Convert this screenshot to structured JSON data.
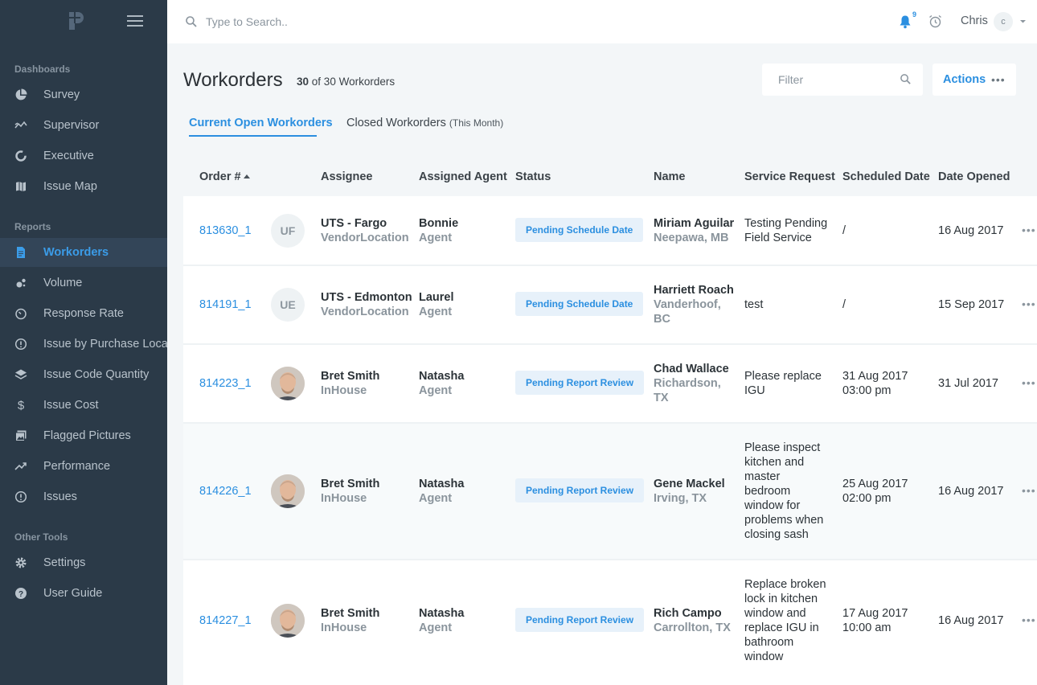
{
  "sidebar": {
    "sections": [
      {
        "label": "Dashboards"
      },
      {
        "label": "Reports"
      },
      {
        "label": "Other Tools"
      }
    ],
    "items": [
      {
        "label": "Survey",
        "icon": "pie-chart-icon"
      },
      {
        "label": "Supervisor",
        "icon": "trend-icon"
      },
      {
        "label": "Executive",
        "icon": "donut-icon"
      },
      {
        "label": "Issue Map",
        "icon": "map-icon"
      },
      {
        "label": "Workorders",
        "icon": "document-icon"
      },
      {
        "label": "Volume",
        "icon": "bubbles-icon"
      },
      {
        "label": "Response Rate",
        "icon": "timer-icon"
      },
      {
        "label": "Issue by Purchase Location",
        "icon": "alert-circle-icon"
      },
      {
        "label": "Issue Code Quantity",
        "icon": "layers-icon"
      },
      {
        "label": "Issue Cost",
        "icon": "dollar-icon"
      },
      {
        "label": "Flagged Pictures",
        "icon": "images-icon"
      },
      {
        "label": "Performance",
        "icon": "trending-up-icon"
      },
      {
        "label": "Issues",
        "icon": "alert-circle-icon"
      },
      {
        "label": "Settings",
        "icon": "gear-icon"
      },
      {
        "label": "User Guide",
        "icon": "help-icon"
      }
    ]
  },
  "topbar": {
    "search_placeholder": "Type to Search..",
    "notification_count": "9",
    "user_name": "Chris",
    "user_initial": "c"
  },
  "header": {
    "title": "Workorders",
    "count_bold": "30",
    "count_rest": "of 30 Workorders",
    "filter_placeholder": "Filter",
    "actions_label": "Actions"
  },
  "tabs": {
    "current": "Current Open Workorders",
    "closed": "Closed Workorders",
    "closed_sub": "(This Month)"
  },
  "columns": {
    "order": "Order #",
    "assignee": "Assignee",
    "agent": "Assigned Agent",
    "status": "Status",
    "name": "Name",
    "service": "Service Request",
    "scheduled": "Scheduled Date",
    "opened": "Date Opened"
  },
  "rows": [
    {
      "order": "813630_1",
      "initials": "UF",
      "assignee": "UTS - Fargo",
      "assignee_type": "VendorLocation",
      "agent": "Bonnie",
      "agent_role": "Agent",
      "status": "Pending Schedule Date",
      "name": "Miriam Aguilar",
      "location": "Neepawa, MB",
      "service": "Testing Pending Field Service",
      "scheduled": "/",
      "scheduled_time": "",
      "opened": "16 Aug 2017"
    },
    {
      "order": "814191_1",
      "initials": "UE",
      "assignee": "UTS - Edmonton",
      "assignee_type": "VendorLocation",
      "agent": "Laurel",
      "agent_role": "Agent",
      "status": "Pending Schedule Date",
      "name": "Harriett Roach",
      "location": "Vanderhoof, BC",
      "service": "test",
      "scheduled": "/",
      "scheduled_time": "",
      "opened": "15 Sep 2017"
    },
    {
      "order": "814223_1",
      "initials": "",
      "assignee": "Bret Smith",
      "assignee_type": "InHouse",
      "agent": "Natasha",
      "agent_role": "Agent",
      "status": "Pending Report Review",
      "name": "Chad Wallace",
      "location": "Richardson, TX",
      "service": "Please replace IGU",
      "scheduled": "31 Aug 2017",
      "scheduled_time": "03:00 pm",
      "opened": "31 Jul 2017"
    },
    {
      "order": "814226_1",
      "initials": "",
      "assignee": "Bret Smith",
      "assignee_type": "InHouse",
      "agent": "Natasha",
      "agent_role": "Agent",
      "status": "Pending Report Review",
      "name": "Gene Mackel",
      "location": "Irving, TX",
      "service": "Please inspect kitchen and master bedroom window for problems when closing sash",
      "scheduled": "25 Aug 2017",
      "scheduled_time": "02:00 pm",
      "opened": "16 Aug 2017"
    },
    {
      "order": "814227_1",
      "initials": "",
      "assignee": "Bret Smith",
      "assignee_type": "InHouse",
      "agent": "Natasha",
      "agent_role": "Agent",
      "status": "Pending Report Review",
      "name": "Rich Campo",
      "location": "Carrollton, TX",
      "service": "Replace broken lock in kitchen window and replace IGU in bathroom window",
      "scheduled": "17 Aug 2017",
      "scheduled_time": "10:00 am",
      "opened": "16 Aug 2017"
    }
  ],
  "colors": {
    "sidebar_bg": "#2b3a48",
    "accent": "#2b8fe0",
    "badge_bg": "#e7f1fa"
  }
}
